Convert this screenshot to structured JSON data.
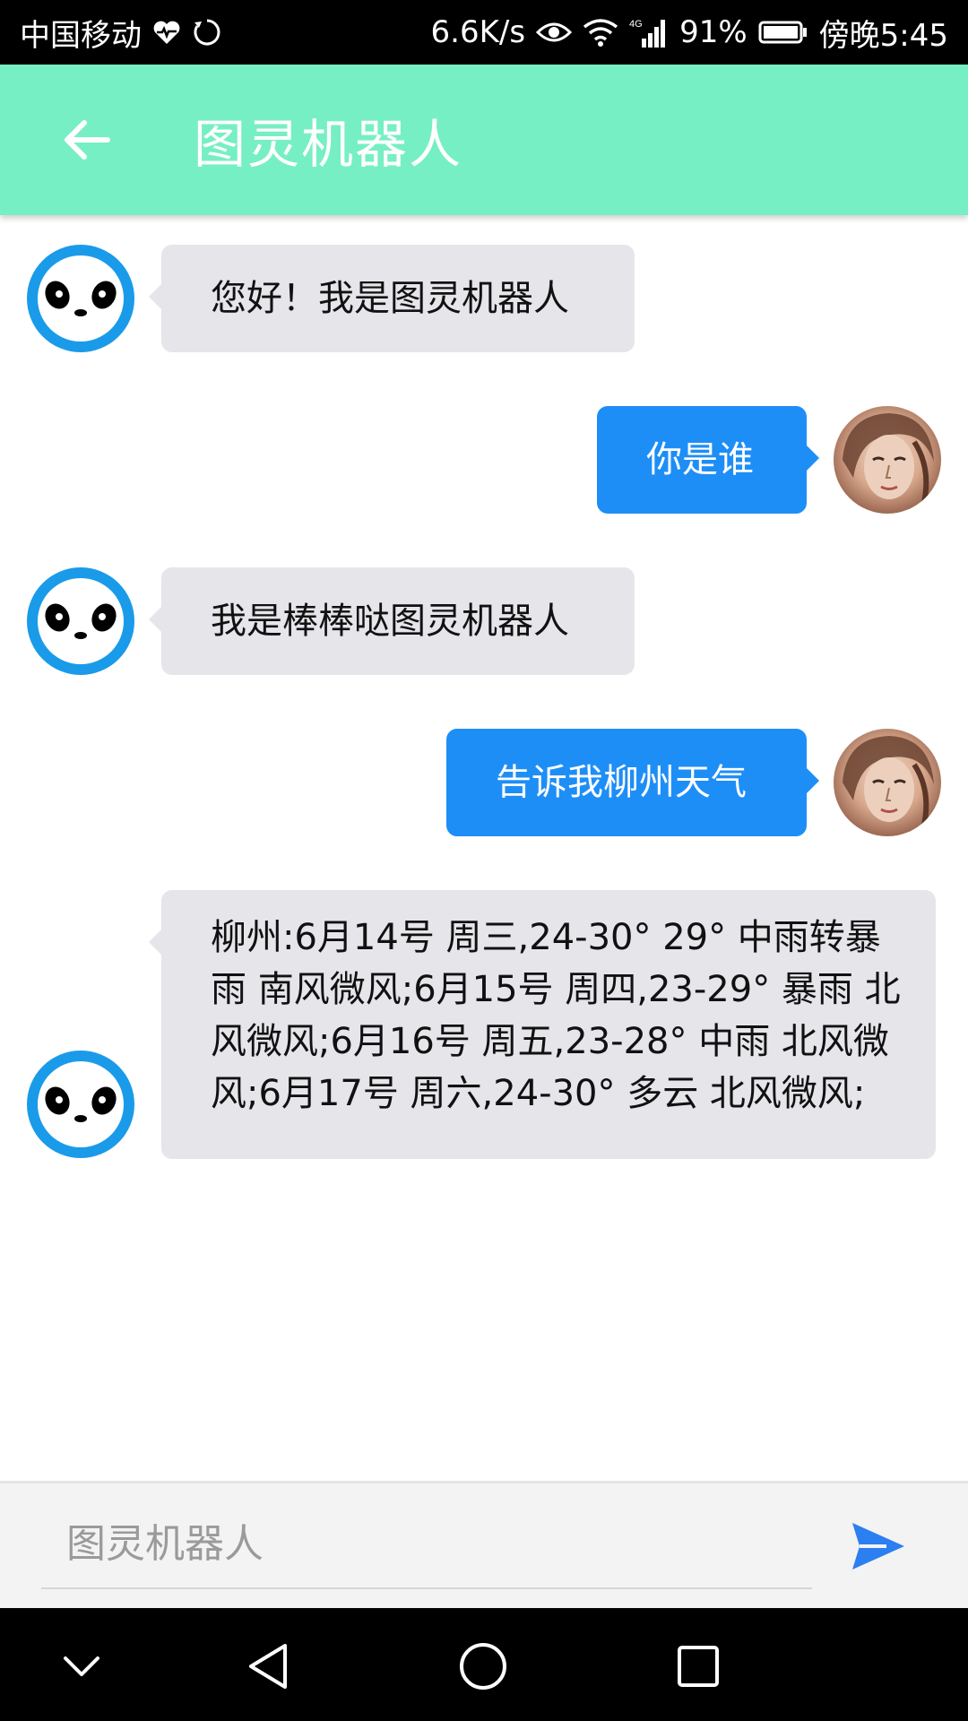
{
  "status_bar": {
    "carrier": "中国移动",
    "network_speed": "6.6K/s",
    "signal_label": "4G",
    "battery_percent": "91%",
    "time": "傍晚5:45",
    "icons": [
      "heartbeat-icon",
      "sync-icon",
      "eye-icon",
      "wifi-icon",
      "signal-icon",
      "battery-icon"
    ]
  },
  "app_bar": {
    "title": "图灵机器人",
    "back_icon": "arrow-left-icon",
    "background_color": "#77efc4"
  },
  "messages": [
    {
      "sender": "bot",
      "text": "您好！我是图灵机器人"
    },
    {
      "sender": "user",
      "text": "你是谁"
    },
    {
      "sender": "bot",
      "text": "我是棒棒哒图灵机器人"
    },
    {
      "sender": "user",
      "text": "告诉我柳州天气"
    },
    {
      "sender": "bot",
      "text": "柳州:6月14号 周三,24-30° 29° 中雨转暴雨 南风微风;6月15号 周四,23-29° 暴雨 北风微风;6月16号 周五,23-28° 中雨 北风微风;6月17号 周六,24-30° 多云 北风微风;"
    }
  ],
  "weather_lines": [
    "柳州:6月14号 周三,24-30° 29° 中雨转暴",
    "雨 南风微风;6月15号 周四,23-29° 暴雨 北",
    "风微风;6月16号 周五,23-28° 中雨 北风微",
    "风;6月17号 周六,24-30° 多云 北风微风;"
  ],
  "input": {
    "placeholder": "图灵机器人",
    "value": ""
  },
  "colors": {
    "bot_bubble": "#e5e5ea",
    "user_bubble": "#1e8ef7",
    "panda_avatar": "#1a9be9",
    "send_icon": "#2b7ff0"
  },
  "nav_bar": {
    "icons": [
      "chevron-down-icon",
      "back-triangle-icon",
      "home-circle-icon",
      "recents-square-icon"
    ]
  }
}
